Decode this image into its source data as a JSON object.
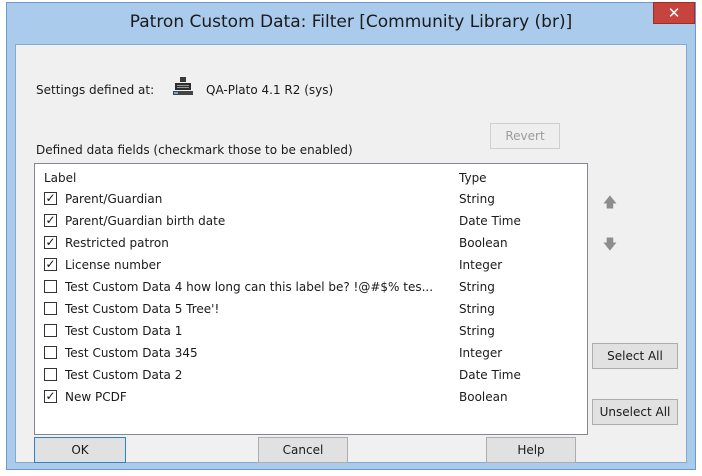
{
  "window": {
    "title": "Patron Custom Data: Filter [Community Library  (br)]",
    "close_glyph": "✕"
  },
  "settings": {
    "label": "Settings defined at:",
    "server_icon": "server-icon",
    "server_name": "QA-Plato 4.1 R2 (sys)"
  },
  "fields": {
    "caption": "Defined data fields (checkmark those to be enabled)",
    "revert_label": "Revert",
    "columns": {
      "label": "Label",
      "type": "Type"
    },
    "rows": [
      {
        "label": "Parent/Guardian",
        "type": "String",
        "checked": true
      },
      {
        "label": "Parent/Guardian birth date",
        "type": "Date Time",
        "checked": true
      },
      {
        "label": "Restricted patron",
        "type": "Boolean",
        "checked": true
      },
      {
        "label": "License number",
        "type": "Integer",
        "checked": true
      },
      {
        "label": "Test Custom Data 4 how long can this label be? !@#$% tes...",
        "type": "String",
        "checked": false
      },
      {
        "label": "Test Custom Data 5 Tree'!",
        "type": "String",
        "checked": false
      },
      {
        "label": "Test Custom Data 1",
        "type": "String",
        "checked": false
      },
      {
        "label": "Test Custom Data 345",
        "type": "Integer",
        "checked": false
      },
      {
        "label": "Test Custom Data 2",
        "type": "Date Time",
        "checked": false
      },
      {
        "label": "New PCDF",
        "type": "Boolean",
        "checked": true
      }
    ]
  },
  "side": {
    "move_up_glyph": "🡅",
    "move_down_glyph": "🡇",
    "select_all_label": "Select All",
    "unselect_all_label": "Unselect All"
  },
  "footer": {
    "ok_label": "OK",
    "cancel_label": "Cancel",
    "help_label": "Help"
  },
  "colors": {
    "title_bar": "#aacbec",
    "close_button": "#c7433d",
    "client_bg": "#f0f0f0"
  }
}
